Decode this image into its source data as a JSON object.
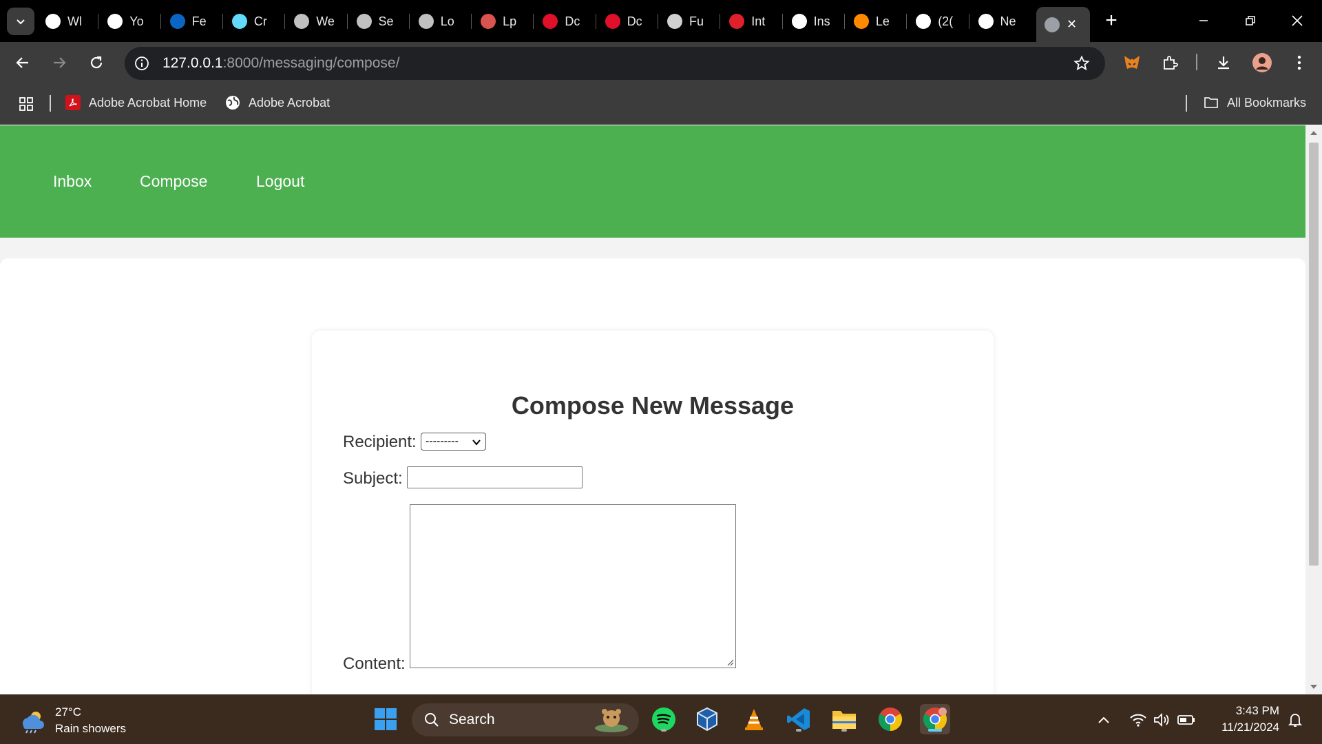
{
  "browser": {
    "tabs": [
      {
        "label": "Wl",
        "icon": "chrome-icon",
        "color": "#ffffff"
      },
      {
        "label": "Yo",
        "icon": "github-icon",
        "color": "#ffffff"
      },
      {
        "label": "Fe",
        "icon": "linkedin-icon",
        "color": "#0a66c2"
      },
      {
        "label": "Cr",
        "icon": "react-icon",
        "color": "#61dafb"
      },
      {
        "label": "We",
        "icon": "globe-icon",
        "color": "#c0c0c0"
      },
      {
        "label": "Se",
        "icon": "globe-icon",
        "color": "#c0c0c0"
      },
      {
        "label": "Lo",
        "icon": "globe-icon",
        "color": "#c0c0c0"
      },
      {
        "label": "Lp",
        "icon": "site-badge-icon",
        "color": "#d9534f"
      },
      {
        "label": "Dc",
        "icon": "m-logo-icon",
        "color": "#e0102a"
      },
      {
        "label": "Dc",
        "icon": "m-logo-icon",
        "color": "#e0102a"
      },
      {
        "label": "Fu",
        "icon": "circle-icon",
        "color": "#d0d0d0"
      },
      {
        "label": "Int",
        "icon": "gauge-icon",
        "color": "#e0202a"
      },
      {
        "label": "Ins",
        "icon": "openai-icon",
        "color": "#ffffff"
      },
      {
        "label": "Le",
        "icon": "m-colorful-icon",
        "color": "#ff8a00"
      },
      {
        "label": "(2(",
        "icon": "x-icon",
        "color": "#ffffff"
      },
      {
        "label": "Ne",
        "icon": "chrome-icon",
        "color": "#ffffff"
      }
    ],
    "active_tab": {
      "icon": "globe-icon",
      "close": "✕"
    },
    "new_tab": "+",
    "url_host": "127.0.0.1",
    "url_rest": ":8000/messaging/compose/",
    "bookmarks": [
      {
        "label": "Adobe Acrobat Home",
        "icon": "adobe-acrobat-icon"
      },
      {
        "label": "Adobe Acrobat",
        "icon": "globe-icon"
      }
    ],
    "all_bookmarks": "All Bookmarks"
  },
  "site": {
    "nav": {
      "inbox": "Inbox",
      "compose": "Compose",
      "logout": "Logout"
    },
    "nav_color": "#4caf50",
    "form": {
      "title": "Compose New Message",
      "recipient_label": "Recipient:",
      "recipient_value": "---------",
      "subject_label": "Subject:",
      "subject_value": "",
      "content_label": "Content:",
      "content_value": ""
    }
  },
  "taskbar": {
    "weather_temp": "27°C",
    "weather_desc": "Rain showers",
    "search_label": "Search",
    "time": "3:43 PM",
    "date": "11/21/2024"
  }
}
